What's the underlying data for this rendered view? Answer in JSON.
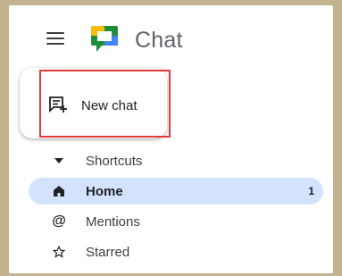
{
  "app": {
    "title": "Chat"
  },
  "new_chat": {
    "label": "New chat"
  },
  "nav": {
    "items": [
      {
        "label": "Shortcuts",
        "icon": "triangle-down-icon"
      },
      {
        "label": "Home",
        "icon": "home-icon",
        "count": "1",
        "active": true
      },
      {
        "label": "Mentions",
        "icon": "at-icon"
      },
      {
        "label": "Starred",
        "icon": "star-icon"
      }
    ]
  },
  "colors": {
    "active_bg": "#d3e3fd",
    "highlight": "#e53935",
    "logo_green": "#1e8e3e",
    "logo_yellow": "#fbbc04",
    "logo_blue": "#4285f4"
  }
}
